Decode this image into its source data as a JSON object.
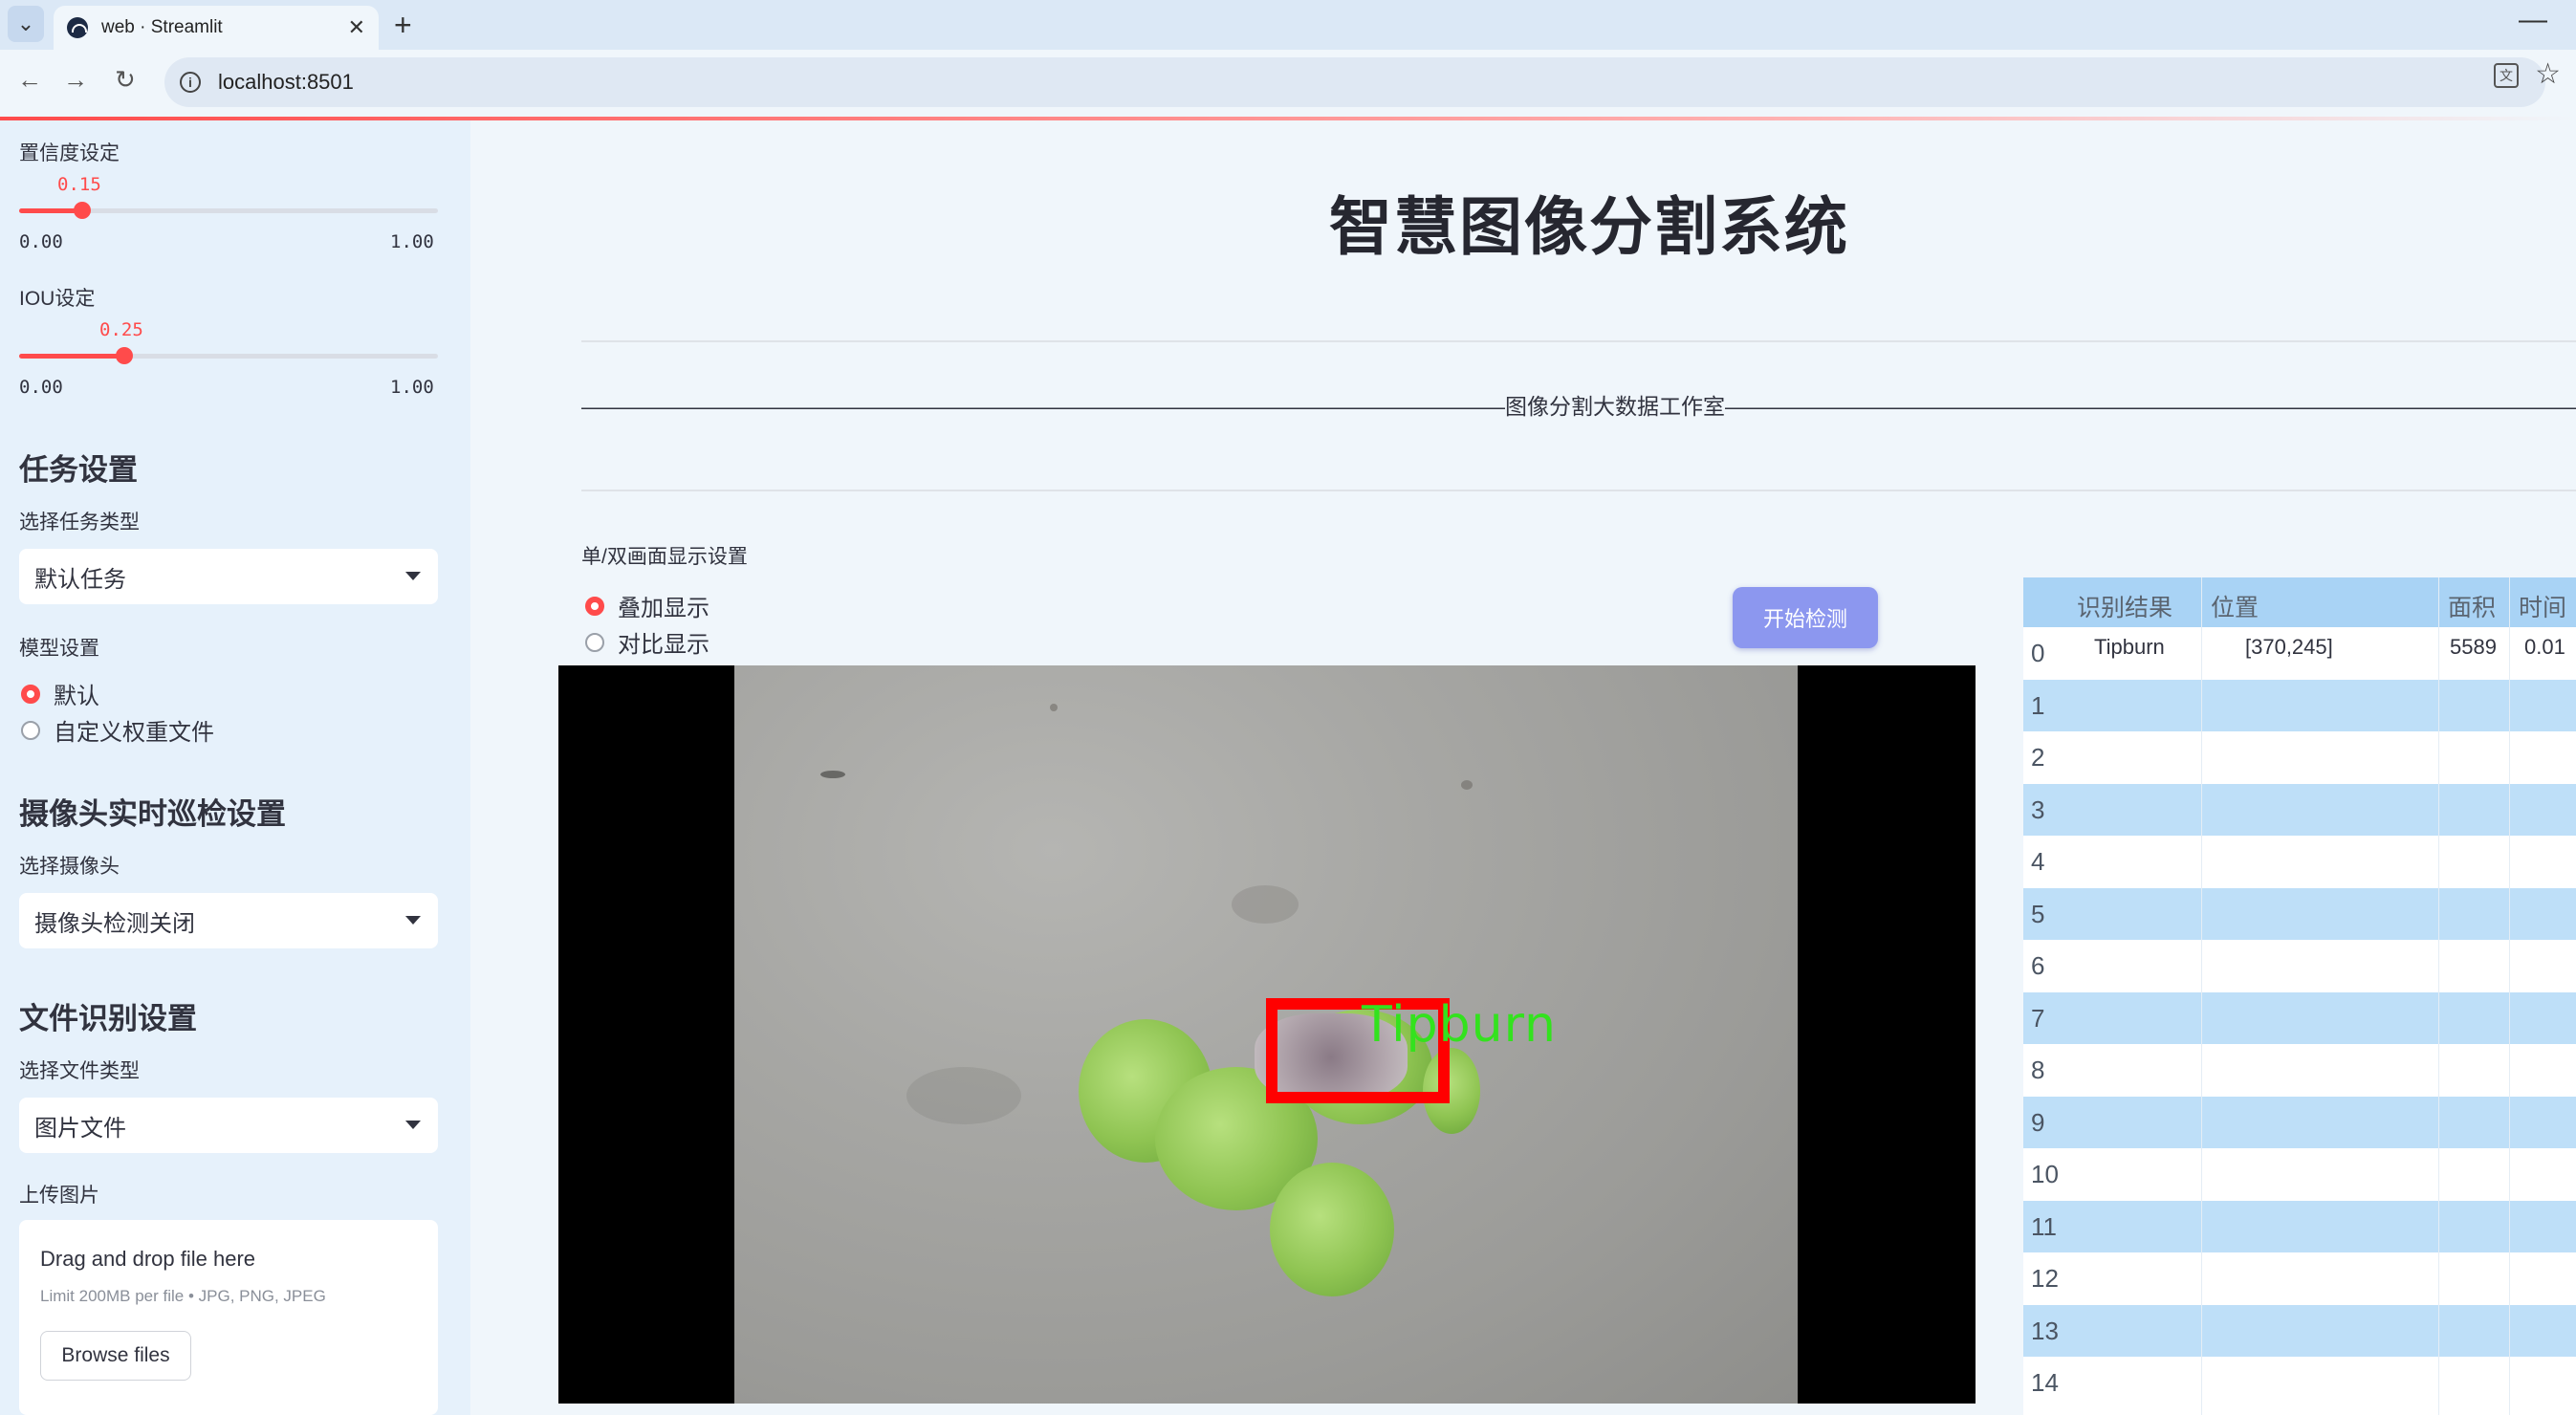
{
  "browser": {
    "tab_title": "web · Streamlit",
    "url": "localhost:8501",
    "tab_close": "✕",
    "new_tab": "+",
    "minimize": "—"
  },
  "sidebar": {
    "confidence": {
      "label": "置信度设定",
      "value": 0.15,
      "value_text": "0.15",
      "min": "0.00",
      "max": "1.00"
    },
    "iou": {
      "label": "IOU设定",
      "value": 0.25,
      "value_text": "0.25",
      "min": "0.00",
      "max": "1.00"
    },
    "task_section": {
      "heading": "任务设置",
      "select_label": "选择任务类型",
      "selected": "默认任务"
    },
    "model_section": {
      "label": "模型设置",
      "options": [
        "默认",
        "自定义权重文件"
      ],
      "selected_index": 0
    },
    "camera_section": {
      "heading": "摄像头实时巡检设置",
      "select_label": "选择摄像头",
      "selected": "摄像头检测关闭"
    },
    "file_section": {
      "heading": "文件识别设置",
      "select_label": "选择文件类型",
      "selected": "图片文件"
    },
    "upload": {
      "label": "上传图片",
      "drop_text": "Drag and drop file here",
      "limit_text": "Limit 200MB per file • JPG, PNG, JPEG",
      "browse_label": "Browse files"
    }
  },
  "main": {
    "title": "智慧图像分割系统",
    "studio_line": "——————————————————————————————————————————图像分割大数据工作室——————————————————————————————————————————",
    "display_label": "单/双画面显示设置",
    "display_options": [
      "叠加显示",
      "对比显示"
    ],
    "display_selected_index": 0,
    "start_button": "开始检测",
    "detection_label": "Tipburn"
  },
  "table": {
    "headers": [
      "识别结果",
      "位置",
      "面积",
      "时间"
    ],
    "rows": [
      {
        "index": "0",
        "result": "Tipburn",
        "position": "[370,245]",
        "area": "5589",
        "time": "0.01"
      },
      {
        "index": "1",
        "result": "",
        "position": "",
        "area": "",
        "time": ""
      },
      {
        "index": "2",
        "result": "",
        "position": "",
        "area": "",
        "time": ""
      },
      {
        "index": "3",
        "result": "",
        "position": "",
        "area": "",
        "time": ""
      },
      {
        "index": "4",
        "result": "",
        "position": "",
        "area": "",
        "time": ""
      },
      {
        "index": "5",
        "result": "",
        "position": "",
        "area": "",
        "time": ""
      },
      {
        "index": "6",
        "result": "",
        "position": "",
        "area": "",
        "time": ""
      },
      {
        "index": "7",
        "result": "",
        "position": "",
        "area": "",
        "time": ""
      },
      {
        "index": "8",
        "result": "",
        "position": "",
        "area": "",
        "time": ""
      },
      {
        "index": "9",
        "result": "",
        "position": "",
        "area": "",
        "time": ""
      },
      {
        "index": "10",
        "result": "",
        "position": "",
        "area": "",
        "time": ""
      },
      {
        "index": "11",
        "result": "",
        "position": "",
        "area": "",
        "time": ""
      },
      {
        "index": "12",
        "result": "",
        "position": "",
        "area": "",
        "time": ""
      },
      {
        "index": "13",
        "result": "",
        "position": "",
        "area": "",
        "time": ""
      },
      {
        "index": "14",
        "result": "",
        "position": "",
        "area": "",
        "time": ""
      }
    ]
  },
  "colors": {
    "accent": "#ff4b4b",
    "sidebar_bg": "#e6f1fb",
    "button_bg": "#8c97ef",
    "table_header": "#a9d3f5",
    "table_alt": "#bedff8",
    "box": "#ff0000",
    "label": "#33e21e"
  }
}
